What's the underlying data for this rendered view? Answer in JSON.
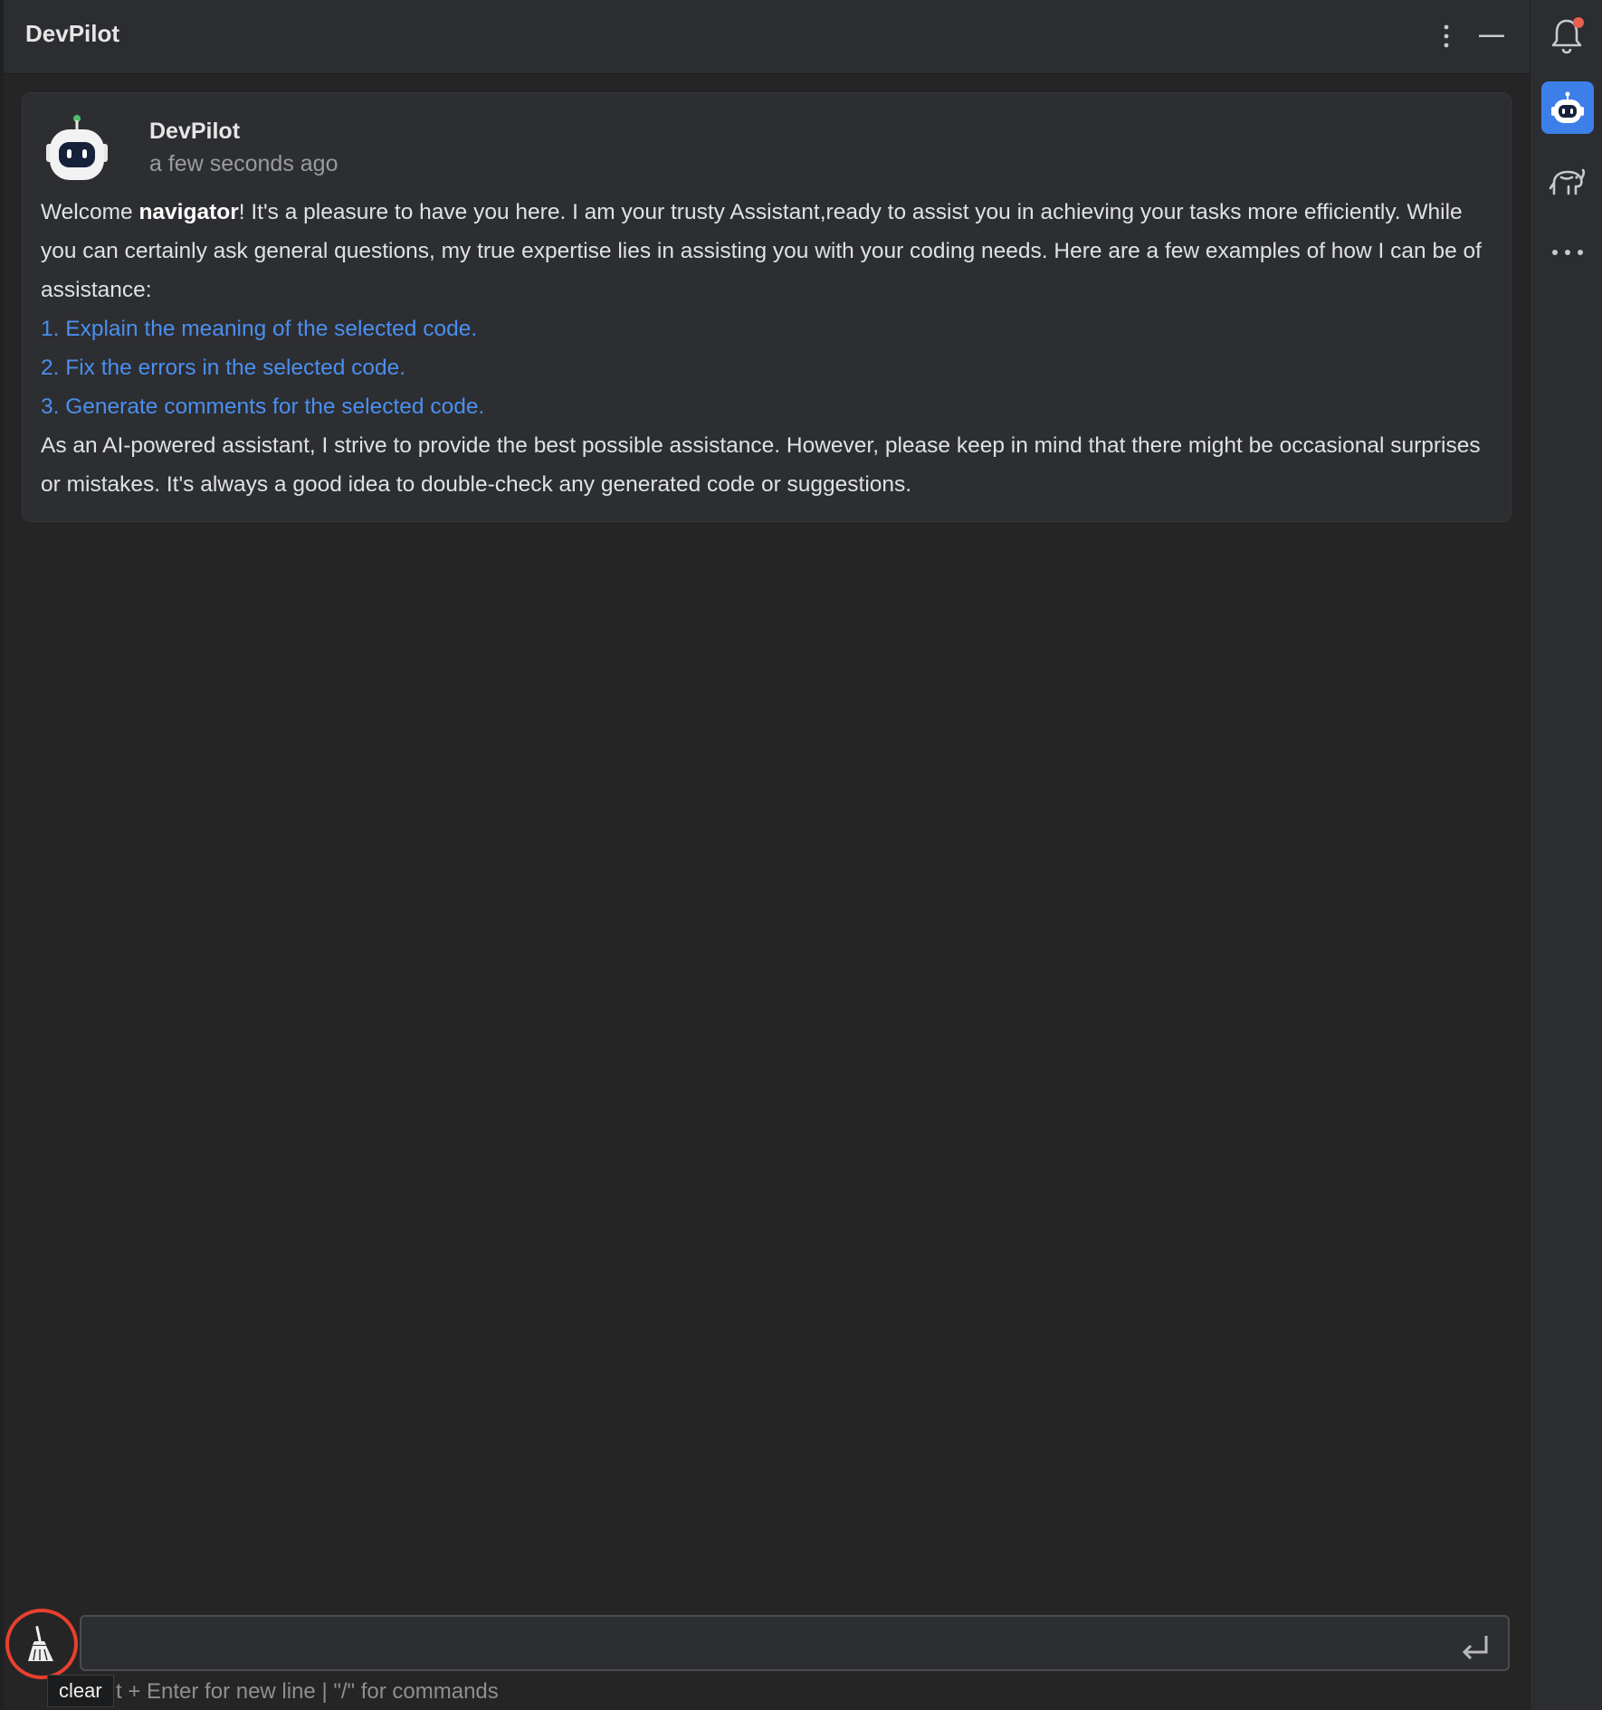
{
  "header": {
    "title": "DevPilot",
    "more_icon": "vertical-ellipsis-icon",
    "minimize_icon": "minimize-icon"
  },
  "message": {
    "sender": "DevPilot",
    "time": "a few seconds ago",
    "welcome_prefix": "Welcome ",
    "username": "navigator",
    "welcome_suffix": "! It's a pleasure to have you here. I am your trusty Assistant,ready to assist you in achieving your tasks more efficiently. While you can certainly ask general questions, my true expertise lies in assisting you with your coding needs. Here are a few examples of how I can be of assistance:",
    "examples": [
      "1. Explain the meaning of the selected code.",
      "2. Fix the errors in the selected code.",
      "3. Generate comments for the selected code."
    ],
    "disclaimer": "As an AI-powered assistant, I strive to provide the best possible assistance. However, please keep in mind that there might be occasional surprises or mistakes. It's always a good idea to double-check any generated code or suggestions."
  },
  "input": {
    "value": "",
    "hint": "t + Enter for new line | \"/\" for commands",
    "clear_tooltip": "clear"
  },
  "right_toolbar": {
    "items": [
      "notifications-icon",
      "devpilot-robot-icon",
      "elephant-icon",
      "more-horizontal-icon"
    ]
  },
  "colors": {
    "accent": "#3d7fe8",
    "link": "#4a8ff0",
    "highlight_ring": "#e8402f",
    "notification_dot": "#e8604f"
  }
}
